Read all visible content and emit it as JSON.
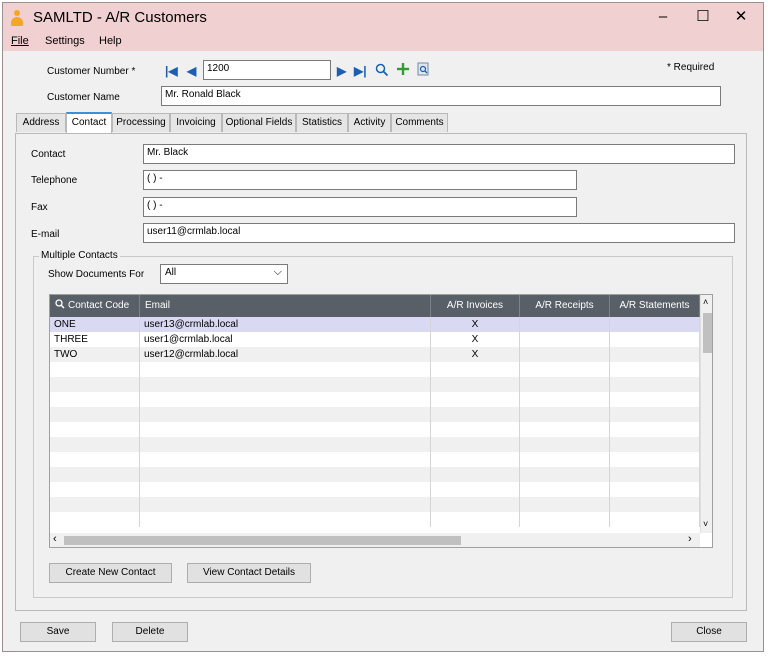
{
  "window": {
    "title": "SAMLTD - A/R Customers",
    "minimize": "–",
    "maximize": "☐",
    "close": "✕"
  },
  "menu": {
    "file": "File",
    "settings": "Settings",
    "help": "Help"
  },
  "header": {
    "customer_number_label": "Customer Number *",
    "customer_number_value": "1200",
    "required_note": "*  Required",
    "customer_name_label": "Customer Name",
    "customer_name_value": "Mr. Ronald Black"
  },
  "tabs": [
    "Address",
    "Contact",
    "Processing",
    "Invoicing",
    "Optional Fields",
    "Statistics",
    "Activity",
    "Comments"
  ],
  "active_tab": "Contact",
  "contact": {
    "contact_label": "Contact",
    "contact_value": "Mr. Black",
    "telephone_label": "Telephone",
    "telephone_value": "(   )    -",
    "fax_label": "Fax",
    "fax_value": "(   )    -",
    "email_label": "E-mail",
    "email_value": "user11@crmlab.local"
  },
  "multiple_contacts": {
    "group_title": "Multiple Contacts",
    "show_documents_label": "Show Documents For",
    "show_documents_value": "All",
    "columns": [
      "Contact Code",
      "Email",
      "A/R Invoices",
      "A/R Receipts",
      "A/R Statements"
    ],
    "rows": [
      {
        "code": "ONE",
        "email": "user13@crmlab.local",
        "invoices": "X",
        "receipts": "",
        "statements": ""
      },
      {
        "code": "THREE",
        "email": "user1@crmlab.local",
        "invoices": "X",
        "receipts": "",
        "statements": ""
      },
      {
        "code": "TWO",
        "email": "user12@crmlab.local",
        "invoices": "X",
        "receipts": "",
        "statements": ""
      }
    ],
    "create_button": "Create New Contact",
    "details_button": "View Contact Details"
  },
  "footer": {
    "save": "Save",
    "delete": "Delete",
    "close": "Close"
  },
  "colors": {
    "titlebar": "#f0d0d0",
    "grid_header": "#585f67",
    "selected_row": "#d9d9f3",
    "nav_accent": "#1a5fb4",
    "add_accent": "#2e9e2e"
  }
}
